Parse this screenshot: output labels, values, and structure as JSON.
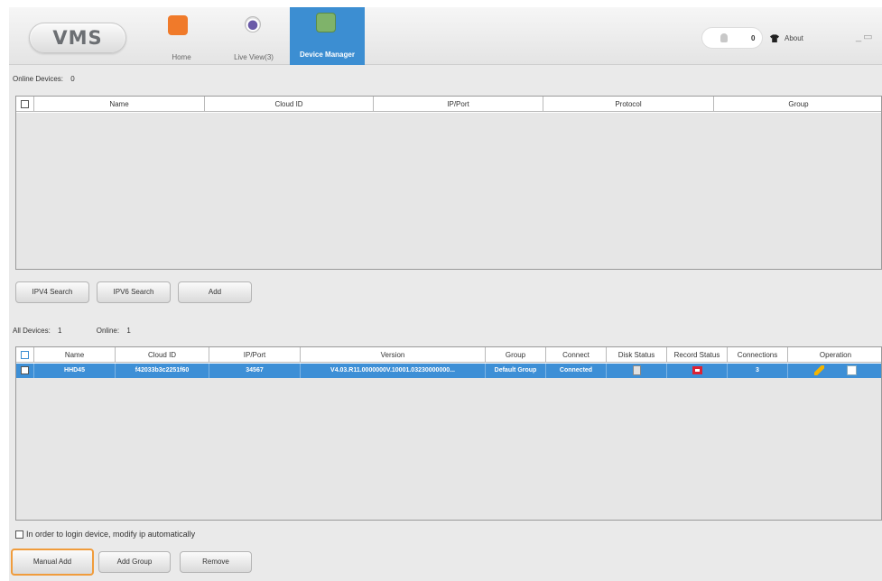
{
  "header": {
    "logo": "VMS",
    "tabs": [
      {
        "label": "Home"
      },
      {
        "label": "Live View(3)"
      },
      {
        "label": "Device Manager"
      }
    ],
    "notif_count": "0",
    "about_label": "About",
    "accent": "#3c8ed2"
  },
  "online": {
    "label": "Online Devices:",
    "count": "0",
    "columns": [
      "Name",
      "Cloud ID",
      "IP/Port",
      "Protocol",
      "Group"
    ]
  },
  "search_buttons": [
    "IPV4 Search",
    "IPV6 Search",
    "Add"
  ],
  "all_devices": {
    "label": "All Devices:",
    "count": "1",
    "online_label": "Online:",
    "online_count": "1",
    "columns": [
      "Name",
      "Cloud ID",
      "IP/Port",
      "Version",
      "Group",
      "Connect",
      "Disk Status",
      "Record Status",
      "Connections",
      "Operation"
    ],
    "rows": [
      {
        "name": "HHD45",
        "cloud_id": "f42033b3c2251f60",
        "ip_port": "34567",
        "version": "V4.03.R11.0000000V.10001.03230000000...",
        "group": "Default Group",
        "connect": "Connected",
        "disk_status": "disk-icon",
        "record_status": "record-icon",
        "connections": "3",
        "operation": [
          "edit-icon",
          "share-icon"
        ]
      }
    ]
  },
  "auto_modify_label": "In order to login device, modify ip automatically",
  "bottom_buttons": [
    "Manual Add",
    "Add Group",
    "Remove"
  ]
}
